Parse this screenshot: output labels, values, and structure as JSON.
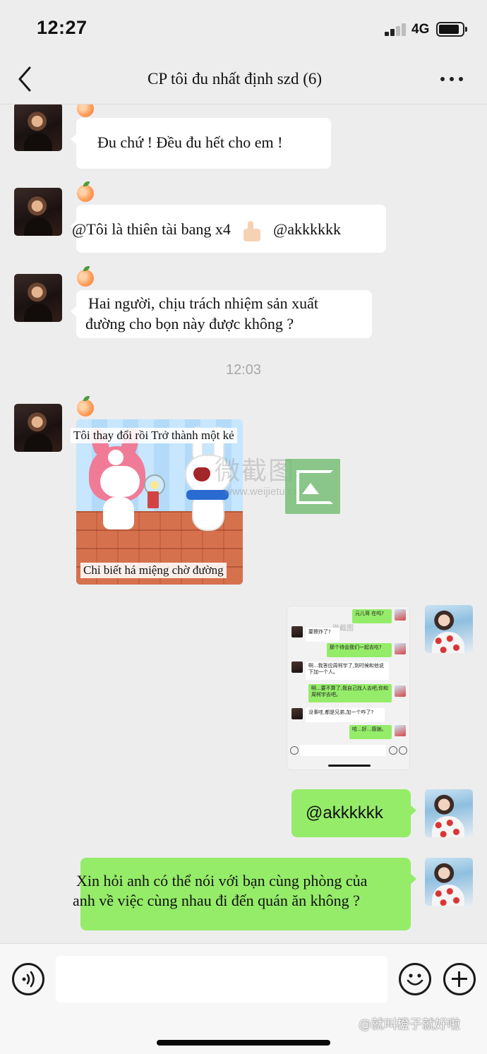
{
  "status_bar": {
    "time": "12:27",
    "network": "4G"
  },
  "header": {
    "title": "CP tôi đu nhất định szd (6)"
  },
  "messages": [
    {
      "side": "left",
      "text": "Đu chứ ! Đều đu hết cho em !"
    },
    {
      "side": "left",
      "text_before": "@Tôi là thiên tài bang x4",
      "text_after": "@akkkkkk",
      "emoji": "thumbs-up-emoji"
    },
    {
      "side": "left",
      "lines": [
        "Hai người, chịu trách nhiệm sản xuất",
        "đường cho bọn này được không ?"
      ]
    },
    {
      "side": "right",
      "text": "@akkkkkk"
    },
    {
      "side": "right",
      "lines": [
        "Xin hỏi anh có thể nói với bạn cùng phòng của",
        "anh về việc cùng nhau đi đến quán ăn không ?"
      ]
    }
  ],
  "timestamp": "12:03",
  "sticker": {
    "caption_top": "Tôi thay đổi rồi Trở thành một kẻ",
    "caption_bottom": "Chỉ biết há miệng chờ đường"
  },
  "watermark": {
    "text": "微截图",
    "url": "www.weijietu.com"
  },
  "screenshot_preview": {
    "header_mark": "微截图",
    "rows": [
      {
        "side": "right",
        "text": "元儿哥 在吗?"
      },
      {
        "side": "left",
        "text": "要擦炸了?"
      },
      {
        "side": "right",
        "text": "那个待会我们一起去吃?"
      },
      {
        "side": "left",
        "text": "啊...我答应周柯宇了,到时候和他说下加一个人。"
      },
      {
        "side": "right",
        "text": "啊...要不算了,我自己找人去吧,你和周柯宇去吧。"
      },
      {
        "side": "left",
        "text": "没事哇,都是兄弟,加一个咋了?"
      },
      {
        "side": "right",
        "text": "哈...好...感谢。"
      }
    ]
  },
  "input_bar": {
    "placeholder": ""
  },
  "credit": "@就叫橙子就好啦",
  "colors": {
    "bubble_green": "#95ec69",
    "background": "#ededed",
    "bubble_white": "#ffffff"
  }
}
